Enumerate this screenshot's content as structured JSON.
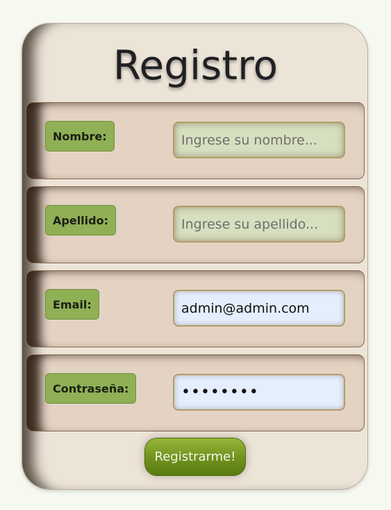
{
  "form": {
    "title": "Registro",
    "fields": [
      {
        "label": "Nombre:",
        "placeholder": "Ingrese su nombre...",
        "value": "",
        "type": "text"
      },
      {
        "label": "Apellido:",
        "placeholder": "Ingrese su apellido...",
        "value": "",
        "type": "text"
      },
      {
        "label": "Email:",
        "placeholder": "",
        "value": "admin@admin.com",
        "type": "email"
      },
      {
        "label": "Contraseña:",
        "placeholder": "",
        "value": "••••••••",
        "type": "password"
      }
    ],
    "submit_label": "Registrarme!"
  },
  "colors": {
    "page_background": "#f6f9ef",
    "card_background": "#ede4d8",
    "row_background": "#e4d3c3",
    "label_green": "#8fb055",
    "button_green": "#6f911c",
    "empty_field": "#d7dfc1",
    "filled_field": "#e4eefc"
  }
}
